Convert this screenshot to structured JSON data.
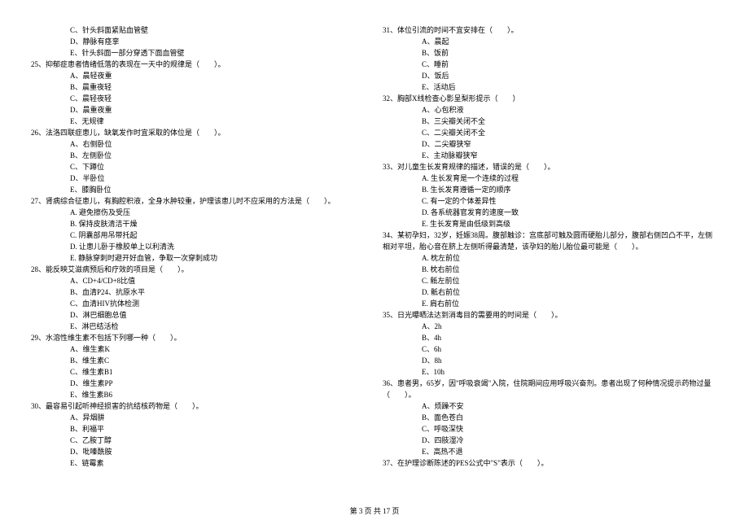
{
  "leftColumn": [
    {
      "type": "option",
      "text": "C、针头斜面紧贴血管壁"
    },
    {
      "type": "option",
      "text": "D、静脉有痉挛"
    },
    {
      "type": "option",
      "text": "E、针头斜面一部分穿透下面血管壁"
    },
    {
      "type": "question",
      "text": "25、抑郁症患者情绪低落的表现在一天中的规律是（　　）。"
    },
    {
      "type": "option",
      "text": "A、晨轻夜重"
    },
    {
      "type": "option",
      "text": "B、晨重夜轻"
    },
    {
      "type": "option",
      "text": "C、晨轻夜轻"
    },
    {
      "type": "option",
      "text": "D、晨重夜重"
    },
    {
      "type": "option",
      "text": "E、无规律"
    },
    {
      "type": "question",
      "text": "26、法洛四联症患儿，缺氧发作时宜采取的体位是（　　）。"
    },
    {
      "type": "option",
      "text": "A、右侧卧位"
    },
    {
      "type": "option",
      "text": "B、左侧卧位"
    },
    {
      "type": "option",
      "text": "C、下蹲位"
    },
    {
      "type": "option",
      "text": "D、半卧位"
    },
    {
      "type": "option",
      "text": "E、膝胸卧位"
    },
    {
      "type": "question",
      "text": "27、肾病综合征患儿，有胸腔积液，全身水肿较重，护理该患儿时不应采用的方法是（　　）。"
    },
    {
      "type": "option",
      "text": "A. 避免擦伤及受压"
    },
    {
      "type": "option",
      "text": "B. 保持皮肤清洁干燥"
    },
    {
      "type": "option",
      "text": "C. 阴囊部用吊带托起"
    },
    {
      "type": "option",
      "text": "D. 让患儿卧于橡胶单上以利清洗"
    },
    {
      "type": "option",
      "text": "E. 静脉穿刺时避开好血管，争取一次穿刺成功"
    },
    {
      "type": "question",
      "text": "28、能反映艾滋病预后和疗效的项目是（　　）。"
    },
    {
      "type": "option",
      "text": "A、CD+4/CD+8比值"
    },
    {
      "type": "option",
      "text": "B、血清P24、抗原水平"
    },
    {
      "type": "option",
      "text": "C、血清HIV抗体检测"
    },
    {
      "type": "option",
      "text": "D、淋巴细胞总值"
    },
    {
      "type": "option",
      "text": "E、淋巴结活检"
    },
    {
      "type": "question",
      "text": "29、水溶性维生素不包括下列哪一种（　　）。"
    },
    {
      "type": "option",
      "text": "A、维生素K"
    },
    {
      "type": "option",
      "text": "B、维生素C"
    },
    {
      "type": "option",
      "text": "C、维生素B1"
    },
    {
      "type": "option",
      "text": "D、维生素PP"
    },
    {
      "type": "option",
      "text": "E、维生素B6"
    },
    {
      "type": "question",
      "text": "30、最容易引起听神经损害的抗结核药物是（　　）。"
    },
    {
      "type": "option",
      "text": "A、异烟肼"
    },
    {
      "type": "option",
      "text": "B、利福平"
    },
    {
      "type": "option",
      "text": "C、乙胺丁醇"
    },
    {
      "type": "option",
      "text": "D、吡嗪酰胺"
    },
    {
      "type": "option",
      "text": "E、链霉素"
    }
  ],
  "rightColumn": [
    {
      "type": "question",
      "text": "31、体位引流的时间不宜安排在（　　）。"
    },
    {
      "type": "option",
      "text": "A、晨起"
    },
    {
      "type": "option",
      "text": "B、饭前"
    },
    {
      "type": "option",
      "text": "C、睡前"
    },
    {
      "type": "option",
      "text": "D、饭后"
    },
    {
      "type": "option",
      "text": "E、活动后"
    },
    {
      "type": "question",
      "text": "32、胸部X线检查心影呈梨形提示（　　）"
    },
    {
      "type": "option",
      "text": "A、心包积液"
    },
    {
      "type": "option",
      "text": "B、三尖瓣关闭不全"
    },
    {
      "type": "option",
      "text": "C、二尖瓣关闭不全"
    },
    {
      "type": "option",
      "text": "D、二尖瓣狭窄"
    },
    {
      "type": "option",
      "text": "E、主动脉瓣狭窄"
    },
    {
      "type": "question",
      "text": "33、对儿童生长发育规律的描述，错误的是（　　）。"
    },
    {
      "type": "option",
      "text": "A. 生长发育是一个连续的过程"
    },
    {
      "type": "option",
      "text": "B. 生长发育遵循一定的顺序"
    },
    {
      "type": "option",
      "text": "C. 有一定的个体差异性"
    },
    {
      "type": "option",
      "text": "D. 各系统器官发育的速度一致"
    },
    {
      "type": "option",
      "text": "E. 生长发育是由低级到高级"
    },
    {
      "type": "question-wrap",
      "text": "34、某初孕妇，32岁，妊娠38周。腹部触诊：宫底部可触及圆而硬胎儿部分，腹部右侧凹凸不平，左侧相对平坦，胎心音在脐上左侧听得最清楚，该孕妇的胎儿胎位最可能是（　　）。"
    },
    {
      "type": "option",
      "text": "A. 枕左前位"
    },
    {
      "type": "option",
      "text": "B. 枕右前位"
    },
    {
      "type": "option",
      "text": "C. 骶左前位"
    },
    {
      "type": "option",
      "text": "D. 骶右前位"
    },
    {
      "type": "option",
      "text": "E. 肩右前位"
    },
    {
      "type": "question",
      "text": "35、日光曝晒法达到消毒目的需要用的时间是（　　）。"
    },
    {
      "type": "option",
      "text": "A、2h"
    },
    {
      "type": "option",
      "text": "B、4h"
    },
    {
      "type": "option",
      "text": "C、6h"
    },
    {
      "type": "option",
      "text": "D、8h"
    },
    {
      "type": "option",
      "text": "E、10h"
    },
    {
      "type": "question-wrap",
      "text": "36、患者男，65岁，因\"呼吸衰竭\"入院，住院期间应用呼吸兴奋剂。患者出现了何种情况提示药物过量（　　）。"
    },
    {
      "type": "option",
      "text": "A、烦躁不安"
    },
    {
      "type": "option",
      "text": "B、面色苍白"
    },
    {
      "type": "option",
      "text": "C、呼吸深快"
    },
    {
      "type": "option",
      "text": "D、四肢湿冷"
    },
    {
      "type": "option",
      "text": "E、高热不退"
    },
    {
      "type": "question",
      "text": "37、在护理诊断陈述的PES公式中\"S\"表示（　　）。"
    }
  ],
  "footer": "第 3 页 共 17 页"
}
